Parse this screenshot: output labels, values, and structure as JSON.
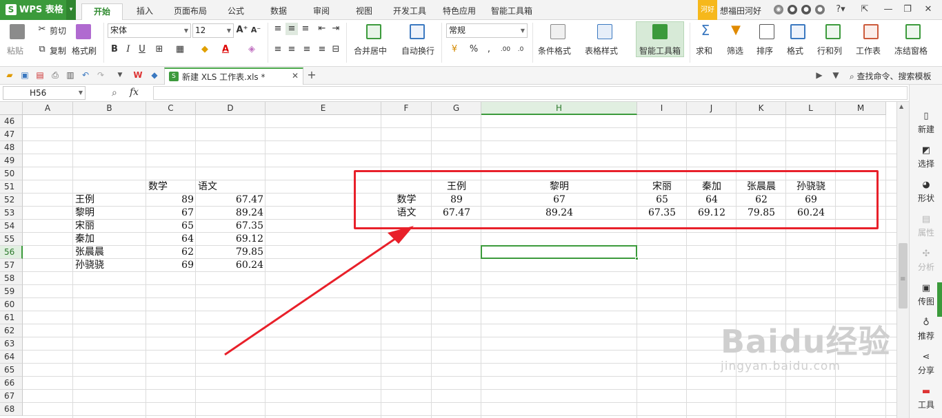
{
  "app": {
    "logo": "WPS 表格",
    "user_badge": "河好",
    "username": "想福田河好"
  },
  "menu_tabs": [
    "开始",
    "插入",
    "页面布局",
    "公式",
    "数据",
    "审阅",
    "视图",
    "开发工具",
    "特色应用",
    "智能工具箱"
  ],
  "ribbon": {
    "paste": "粘贴",
    "cut": "剪切",
    "copy": "复制",
    "format_painter": "格式刷",
    "font_name": "宋体",
    "font_size": "12",
    "merge_center": "合并居中",
    "wrap_text": "自动换行",
    "number_format": "常规",
    "conditional_format": "条件格式",
    "table_style": "表格样式",
    "smart_toolbox": "智能工具箱",
    "sum": "求和",
    "filter": "筛选",
    "sort": "排序",
    "format": "格式",
    "row_col": "行和列",
    "worksheet": "工作表",
    "freeze": "冻结窗格"
  },
  "doc_tab": {
    "name": "新建 XLS 工作表.xls *"
  },
  "search_cmd": "查找命令、搜索模板",
  "formula_bar": {
    "cell_ref": "H56",
    "fx": "fx",
    "value": ""
  },
  "columns": [
    "A",
    "B",
    "C",
    "D",
    "E",
    "F",
    "G",
    "H",
    "I",
    "J",
    "K",
    "L",
    "M"
  ],
  "rows": [
    "46",
    "47",
    "48",
    "49",
    "50",
    "51",
    "52",
    "53",
    "54",
    "55",
    "56",
    "57",
    "58",
    "59",
    "60",
    "61",
    "62",
    "63",
    "64",
    "65",
    "66",
    "67",
    "68"
  ],
  "source_table": {
    "headers": [
      "数学",
      "语文"
    ],
    "rows": [
      {
        "name": "王例",
        "math": "89",
        "chinese": "67.47"
      },
      {
        "name": "黎明",
        "math": "67",
        "chinese": "89.24"
      },
      {
        "name": "宋丽",
        "math": "65",
        "chinese": "67.35"
      },
      {
        "name": "秦加",
        "math": "64",
        "chinese": "69.12"
      },
      {
        "name": "张晨晨",
        "math": "62",
        "chinese": "79.85"
      },
      {
        "name": "孙骁骁",
        "math": "69",
        "chinese": "60.24"
      }
    ]
  },
  "transposed_table": {
    "row_labels": [
      "数学",
      "语文"
    ],
    "names": [
      "王例",
      "黎明",
      "宋丽",
      "秦加",
      "张晨晨",
      "孙骁骁"
    ],
    "math": [
      "89",
      "67",
      "65",
      "64",
      "62",
      "69"
    ],
    "chinese": [
      "67.47",
      "89.24",
      "67.35",
      "69.12",
      "79.85",
      "60.24"
    ]
  },
  "sidebar": [
    "新建",
    "选择",
    "形状",
    "属性",
    "分析",
    "传图",
    "推荐",
    "分享",
    "工具"
  ],
  "watermark": {
    "brand": "Baidu经验",
    "url": "jingyan.baidu.com"
  },
  "colors": {
    "accent_green": "#3b9a3b",
    "annotation_red": "#e8202a"
  }
}
